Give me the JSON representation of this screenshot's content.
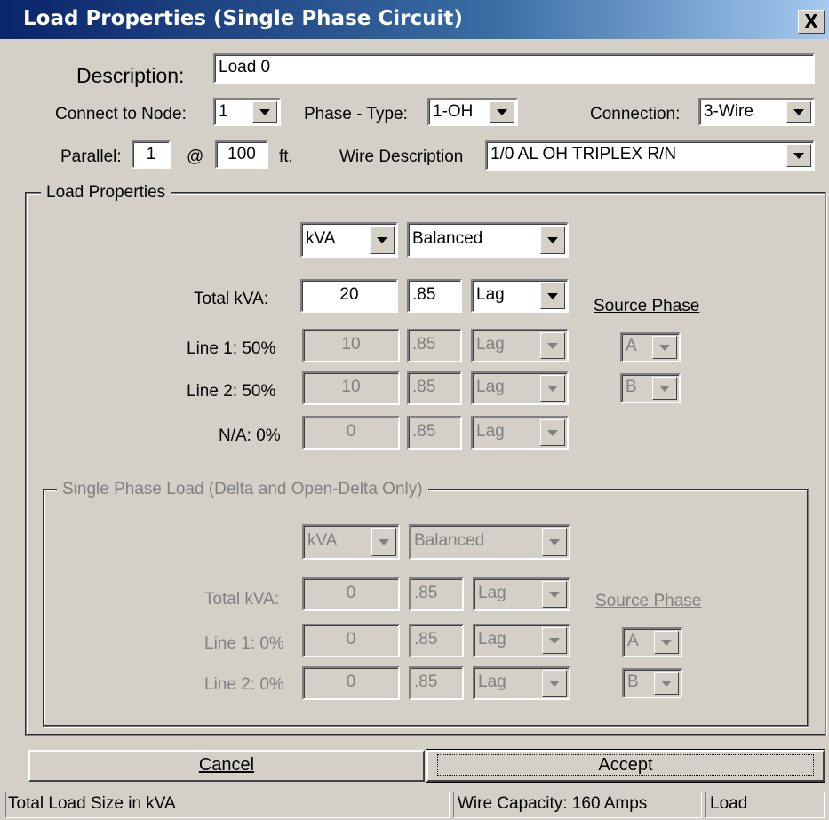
{
  "window": {
    "title": "Load Properties (Single Phase Circuit)",
    "close_label": "X"
  },
  "top": {
    "description_label": "Description:",
    "description_value": "Load 0",
    "connect_label": "Connect to Node:",
    "connect_value": "1",
    "phase_type_label": "Phase - Type:",
    "phase_type_value": "1-OH",
    "connection_label": "Connection:",
    "connection_value": "3-Wire",
    "parallel_label": "Parallel:",
    "parallel_value": "1",
    "at_label": "@",
    "length_value": "100",
    "length_unit": "ft.",
    "wire_label": "Wire Description",
    "wire_value": "1/0 AL OH TRIPLEX R/N"
  },
  "load_group": {
    "title": "Load Properties",
    "unit_value": "kVA",
    "mode_value": "Balanced",
    "total_label": "Total kVA:",
    "total_value": "20",
    "total_pf": ".85",
    "total_lag": "Lag",
    "source_phase_label": "Source Phase",
    "rows": [
      {
        "label": "Line 1: 50%",
        "value": "10",
        "pf": ".85",
        "lag": "Lag",
        "phase": "A"
      },
      {
        "label": "Line 2: 50%",
        "value": "10",
        "pf": ".85",
        "lag": "Lag",
        "phase": "B"
      },
      {
        "label": "N/A: 0%",
        "value": "0",
        "pf": ".85",
        "lag": "Lag"
      }
    ]
  },
  "single_group": {
    "title": "Single Phase Load (Delta and Open-Delta Only)",
    "unit_value": "kVA",
    "mode_value": "Balanced",
    "total_label": "Total kVA:",
    "total_value": "0",
    "total_pf": ".85",
    "total_lag": "Lag",
    "source_phase_label": "Source Phase",
    "rows": [
      {
        "label": "Line 1: 0%",
        "value": "0",
        "pf": ".85",
        "lag": "Lag",
        "phase": "A"
      },
      {
        "label": "Line 2: 0%",
        "value": "0",
        "pf": ".85",
        "lag": "Lag",
        "phase": "B"
      }
    ]
  },
  "buttons": {
    "cancel": "Cancel",
    "accept": "Accept"
  },
  "status": {
    "hint": "Total Load Size in kVA",
    "capacity": "Wire Capacity: 160 Amps",
    "mode": "Load"
  }
}
